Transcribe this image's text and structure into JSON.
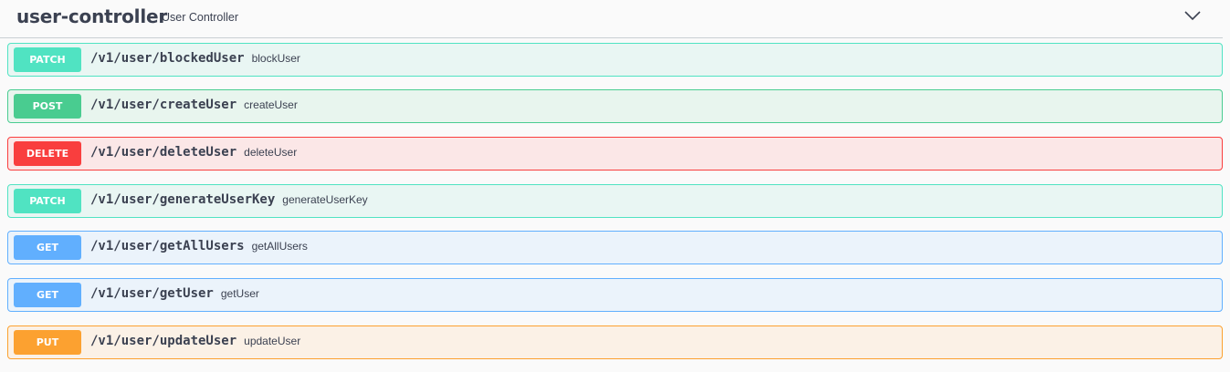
{
  "tag": {
    "name": "user-controller",
    "description": "User Controller"
  },
  "operations": [
    {
      "method": "PATCH",
      "path": "/v1/user/blockedUser",
      "summary": "blockUser"
    },
    {
      "method": "POST",
      "path": "/v1/user/createUser",
      "summary": "createUser"
    },
    {
      "method": "DELETE",
      "path": "/v1/user/deleteUser",
      "summary": "deleteUser"
    },
    {
      "method": "PATCH",
      "path": "/v1/user/generateUserKey",
      "summary": "generateUserKey"
    },
    {
      "method": "GET",
      "path": "/v1/user/getAllUsers",
      "summary": "getAllUsers"
    },
    {
      "method": "GET",
      "path": "/v1/user/getUser",
      "summary": "getUser"
    },
    {
      "method": "PUT",
      "path": "/v1/user/updateUser",
      "summary": "updateUser"
    }
  ],
  "colors": {
    "patch": "#50e3c2",
    "post": "#49cc90",
    "delete": "#f93e3e",
    "get": "#61affe",
    "put": "#fca130",
    "text": "#3b4151"
  },
  "icons": {
    "collapse": "chevron-down-icon"
  }
}
